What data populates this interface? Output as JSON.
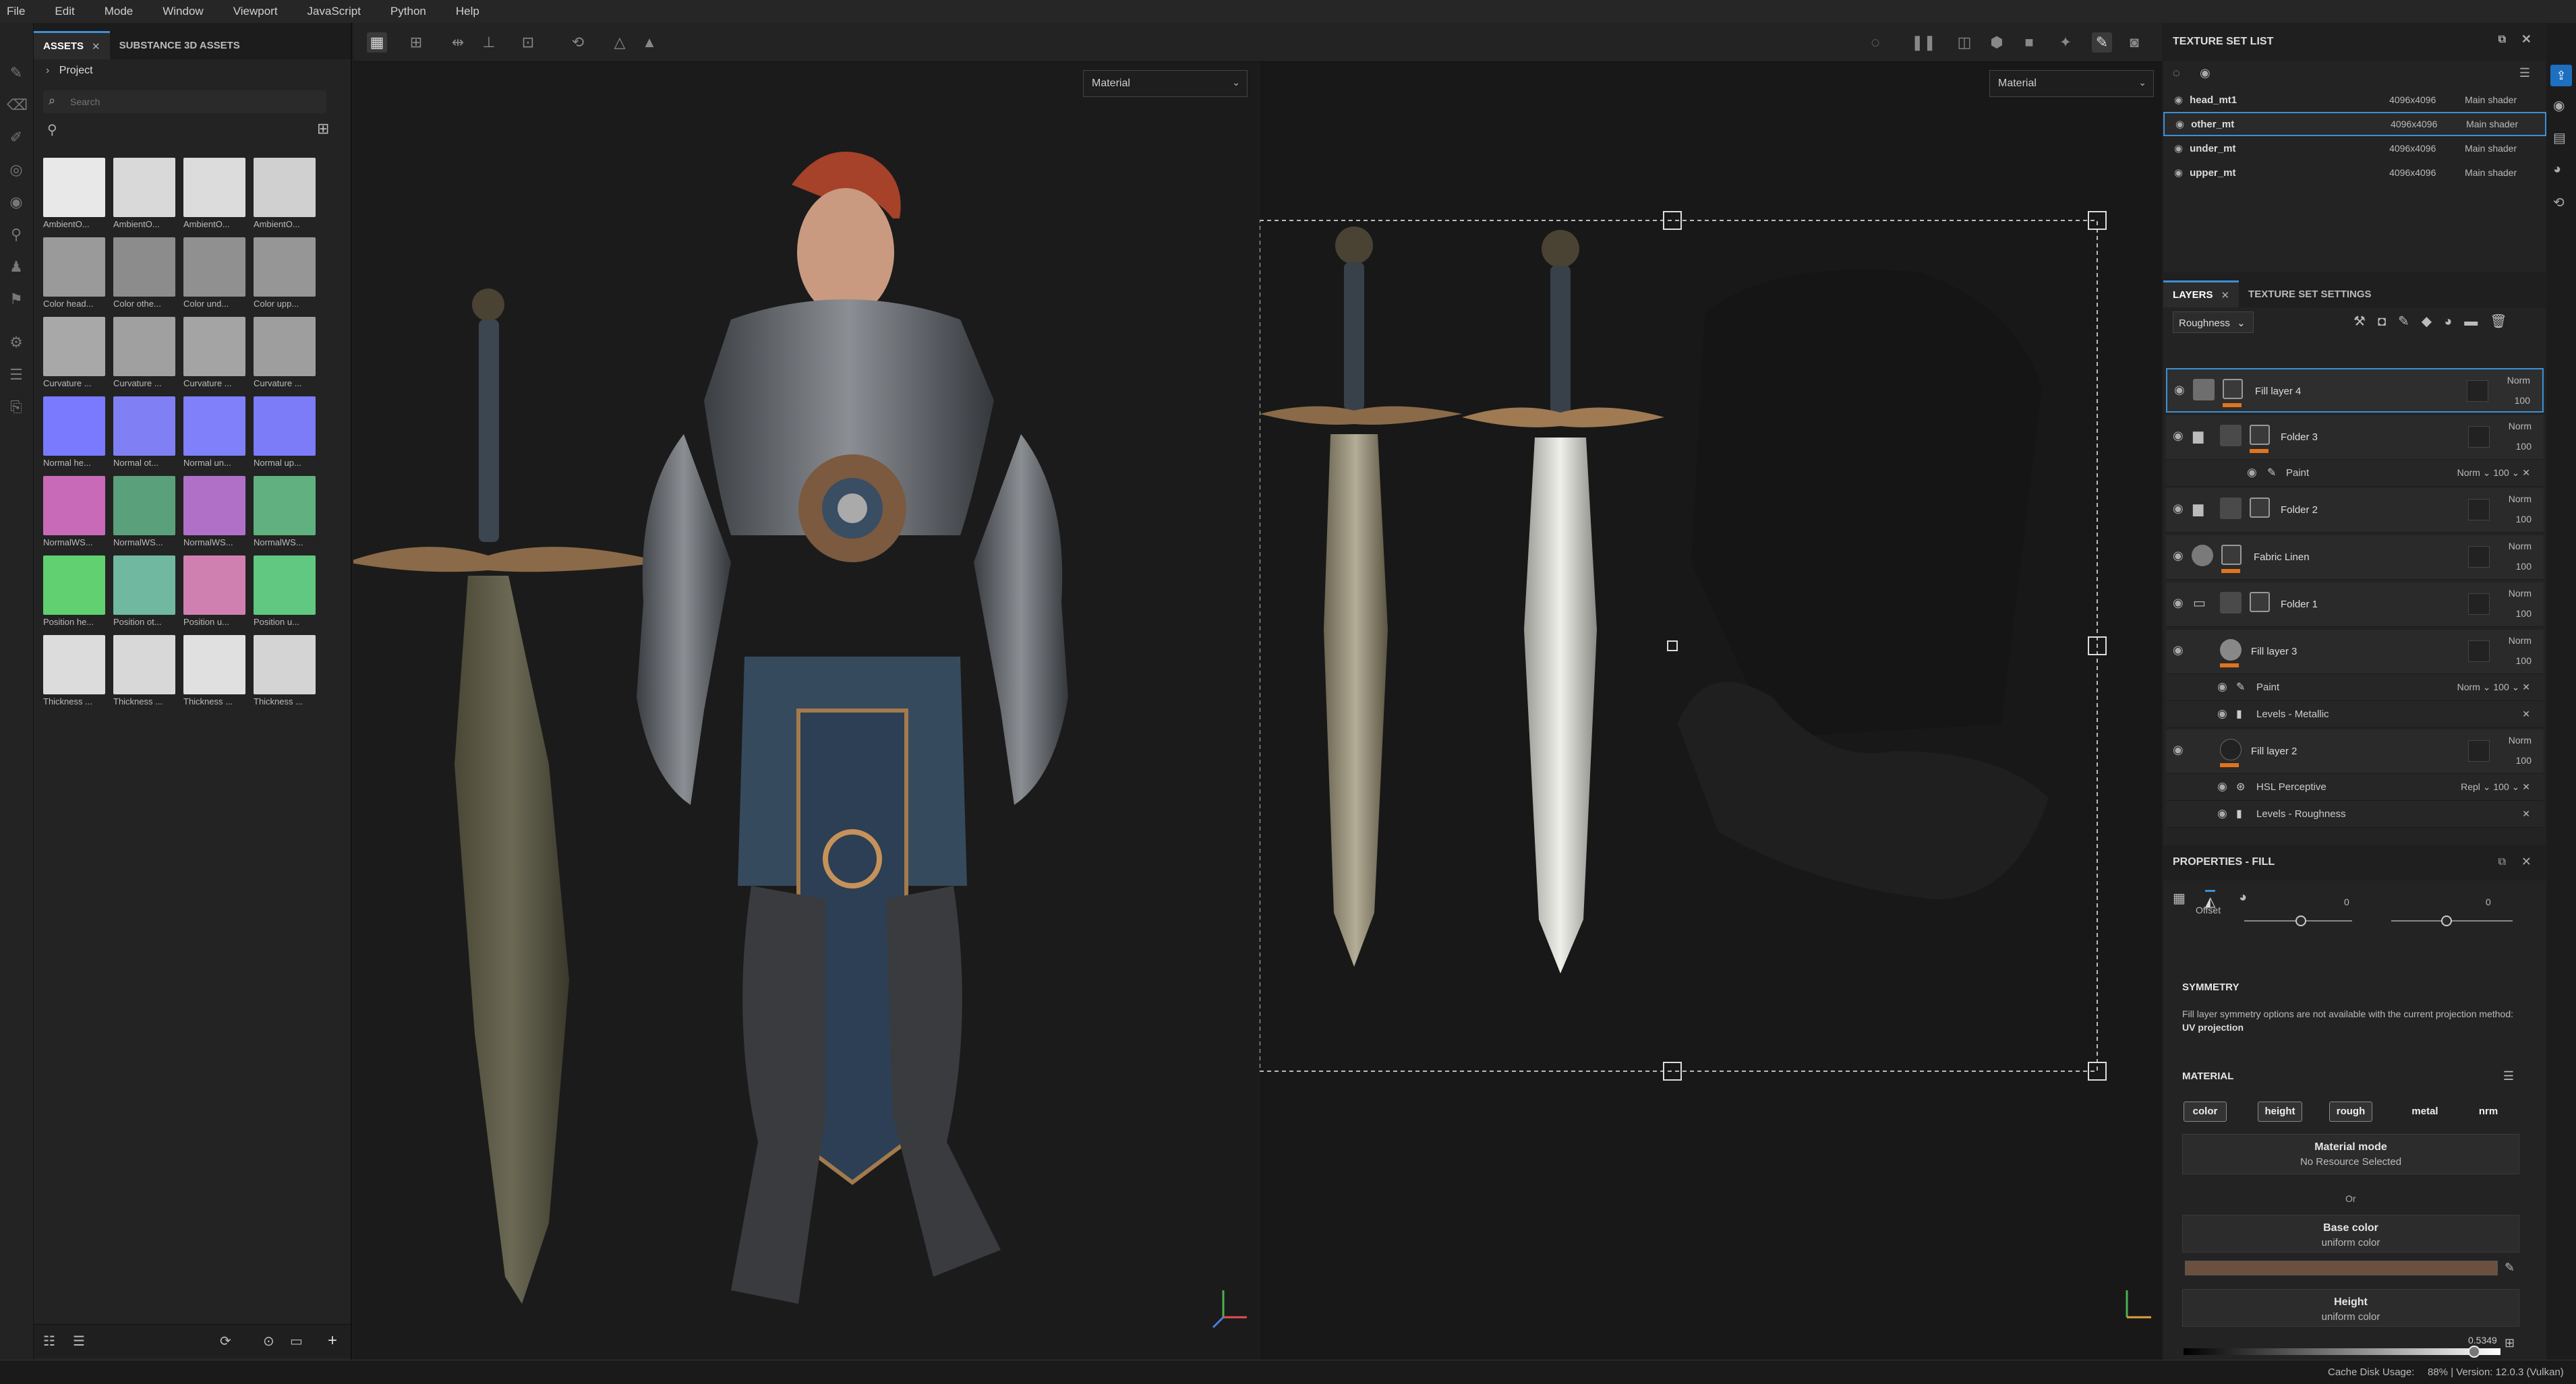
{
  "menu": [
    "File",
    "Edit",
    "Mode",
    "Window",
    "Viewport",
    "JavaScript",
    "Python",
    "Help"
  ],
  "assets": {
    "tabs": [
      {
        "label": "ASSETS"
      },
      {
        "label": "SUBSTANCE 3D ASSETS"
      }
    ],
    "breadcrumb": "Project",
    "search_placeholder": "Search",
    "thumbnails": [
      {
        "label": "AmbientO...",
        "color": "#e8e8e8"
      },
      {
        "label": "AmbientO...",
        "color": "#d9d9d9"
      },
      {
        "label": "AmbientO...",
        "color": "#dcdcdc"
      },
      {
        "label": "AmbientO...",
        "color": "#d0d0d0"
      },
      {
        "label": "Color head...",
        "color": "#9a9a9a"
      },
      {
        "label": "Color othe...",
        "color": "#8c8c8c"
      },
      {
        "label": "Color und...",
        "color": "#909090"
      },
      {
        "label": "Color upp...",
        "color": "#969696"
      },
      {
        "label": "Curvature ...",
        "color": "#a8a8a8"
      },
      {
        "label": "Curvature ...",
        "color": "#a0a0a0"
      },
      {
        "label": "Curvature ...",
        "color": "#a4a4a4"
      },
      {
        "label": "Curvature ...",
        "color": "#9e9e9e"
      },
      {
        "label": "Normal he...",
        "color": "#7a7aff"
      },
      {
        "label": "Normal ot...",
        "color": "#8080f4"
      },
      {
        "label": "Normal un...",
        "color": "#7f80fa"
      },
      {
        "label": "Normal up...",
        "color": "#7c7cf8"
      },
      {
        "label": "NormalWS...",
        "color": "#c86ab8"
      },
      {
        "label": "NormalWS...",
        "color": "#5aa07a"
      },
      {
        "label": "NormalWS...",
        "color": "#b070c8"
      },
      {
        "label": "NormalWS...",
        "color": "#60b080"
      },
      {
        "label": "Position he...",
        "color": "#60d070"
      },
      {
        "label": "Position ot...",
        "color": "#70b8a0"
      },
      {
        "label": "Position u...",
        "color": "#d080b0"
      },
      {
        "label": "Position u...",
        "color": "#60c880"
      },
      {
        "label": "Thickness ...",
        "color": "#dcdcdc"
      },
      {
        "label": "Thickness ...",
        "color": "#d8d8d8"
      },
      {
        "label": "Thickness ...",
        "color": "#e0e0e0"
      },
      {
        "label": "Thickness ...",
        "color": "#d4d4d4"
      }
    ]
  },
  "viewport3d": {
    "dropdown": "Material"
  },
  "viewport2d": {
    "dropdown": "Material"
  },
  "texture_set_list": {
    "title": "TEXTURE SET LIST",
    "sets": [
      {
        "name": "head_mt1",
        "size": "4096x4096",
        "shader": "Main shader"
      },
      {
        "name": "other_mt",
        "size": "4096x4096",
        "shader": "Main shader"
      },
      {
        "name": "under_mt",
        "size": "4096x4096",
        "shader": "Main shader"
      },
      {
        "name": "upper_mt",
        "size": "4096x4096",
        "shader": "Main shader"
      }
    ]
  },
  "layers": {
    "tab_layers": "LAYERS",
    "tab_settings": "TEXTURE SET SETTINGS",
    "channel": "Roughness",
    "items": [
      {
        "name": "Fill layer 4",
        "blend": "Norm",
        "opacity": "100"
      },
      {
        "name": "Folder 3",
        "blend": "Norm",
        "opacity": "100"
      },
      {
        "name": "Paint",
        "blend": "Norm",
        "opacity": "100"
      },
      {
        "name": "Folder 2",
        "blend": "Norm",
        "opacity": "100"
      },
      {
        "name": "Fabric Linen",
        "blend": "Norm",
        "opacity": "100"
      },
      {
        "name": "Folder 1",
        "blend": "Norm",
        "opacity": "100"
      },
      {
        "name": "Fill layer 3",
        "blend": "Norm",
        "opacity": "100"
      },
      {
        "name": "Paint",
        "blend": "Norm",
        "opacity": "100"
      },
      {
        "name": "Levels - Metallic",
        "blend": "",
        "opacity": ""
      },
      {
        "name": "Fill layer 2",
        "blend": "Norm",
        "opacity": "100"
      },
      {
        "name": "HSL Perceptive",
        "blend": "Repl",
        "opacity": "100"
      },
      {
        "name": "Levels - Roughness",
        "blend": "",
        "opacity": ""
      }
    ]
  },
  "properties": {
    "title": "PROPERTIES - FILL",
    "offset_label": "Offset",
    "offset_values": [
      "0",
      "0"
    ],
    "symmetry_title": "SYMMETRY",
    "symmetry_text": "Fill layer symmetry options are not available with the current projection method:",
    "symmetry_method": "UV projection",
    "material_title": "MATERIAL",
    "channels": [
      "color",
      "height",
      "rough",
      "metal",
      "nrm"
    ],
    "material_mode": "Material mode",
    "no_resource": "No Resource Selected",
    "or": "Or",
    "base_color": "Base color",
    "uniform_color": "uniform color",
    "height": "Height",
    "height_uniform": "uniform color",
    "height_value": "0.5349",
    "height_fraction": 0.5349
  },
  "status": {
    "cache": "Cache Disk Usage:",
    "usage": "88% | Version: 12.0.3 (Vulkan)"
  },
  "colors": {
    "accent": "#3d8fd6",
    "orange": "#e0741e"
  }
}
